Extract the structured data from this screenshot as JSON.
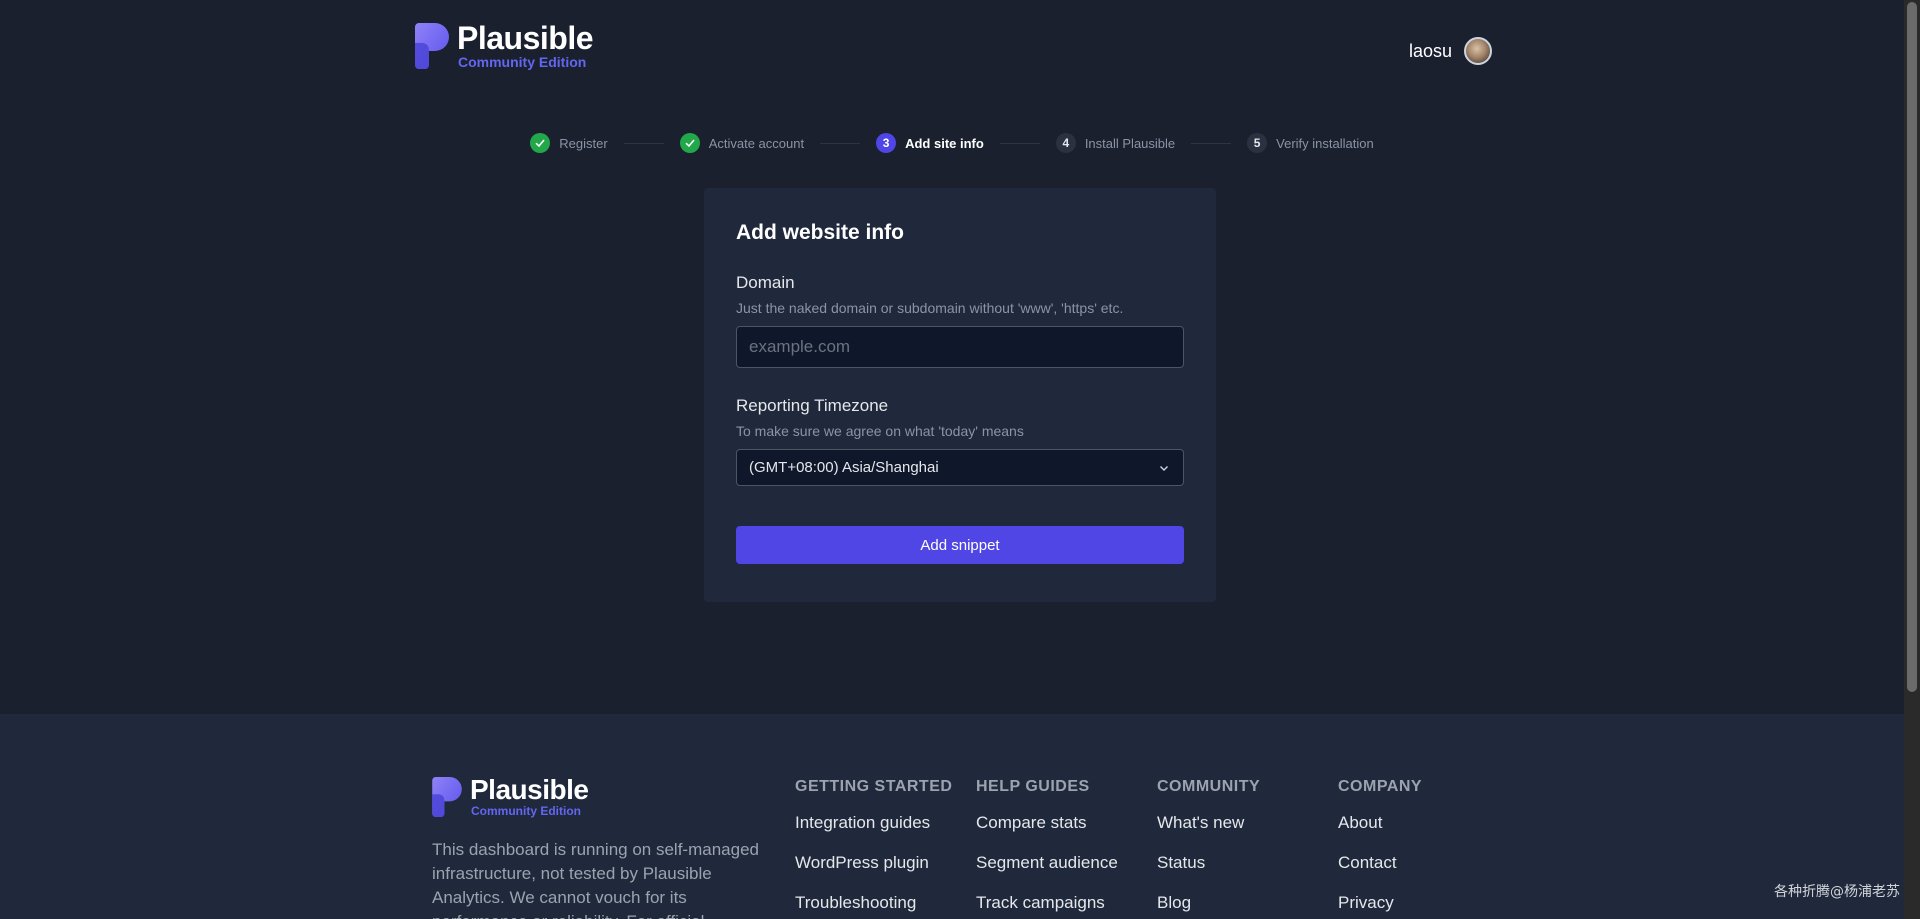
{
  "brand": {
    "name": "Plausible",
    "edition": "Community Edition",
    "primary_color": "#4f46e5"
  },
  "header": {
    "username": "laosu"
  },
  "stepper": {
    "steps": [
      {
        "num": "1",
        "label": "Register",
        "state": "done"
      },
      {
        "num": "2",
        "label": "Activate account",
        "state": "done"
      },
      {
        "num": "3",
        "label": "Add site info",
        "state": "active"
      },
      {
        "num": "4",
        "label": "Install Plausible",
        "state": "todo"
      },
      {
        "num": "5",
        "label": "Verify installation",
        "state": "todo"
      }
    ]
  },
  "form": {
    "title": "Add website info",
    "domain": {
      "label": "Domain",
      "help": "Just the naked domain or subdomain without 'www', 'https' etc.",
      "placeholder": "example.com",
      "value": ""
    },
    "timezone": {
      "label": "Reporting Timezone",
      "help": "To make sure we agree on what 'today' means",
      "selected": "(GMT+08:00) Asia/Shanghai"
    },
    "submit_label": "Add snippet"
  },
  "footer": {
    "description": "This dashboard is running on self-managed infrastructure, not tested by Plausible Analytics. We cannot vouch for its performance or reliability. For official",
    "columns": [
      {
        "title": "GETTING STARTED",
        "links": [
          "Integration guides",
          "WordPress plugin",
          "Troubleshooting"
        ]
      },
      {
        "title": "HELP GUIDES",
        "links": [
          "Compare stats",
          "Segment audience",
          "Track campaigns"
        ]
      },
      {
        "title": "COMMUNITY",
        "links": [
          "What's new",
          "Status",
          "Blog"
        ]
      },
      {
        "title": "COMPANY",
        "links": [
          "About",
          "Contact",
          "Privacy"
        ]
      }
    ]
  },
  "watermark": "各种折腾@杨浦老苏"
}
